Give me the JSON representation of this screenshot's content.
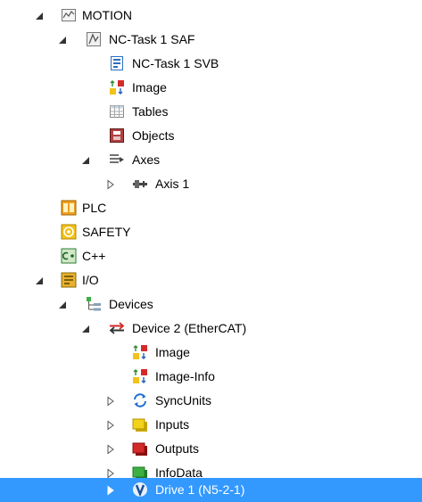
{
  "tree": {
    "motion": {
      "label": "MOTION",
      "icon": "motion-icon"
    },
    "nc_task": {
      "label": "NC-Task 1 SAF",
      "icon": "nc-task-icon"
    },
    "nc_task_svb": {
      "label": "NC-Task 1 SVB",
      "icon": "svb-icon"
    },
    "nc_image": {
      "label": "Image",
      "icon": "image-icon"
    },
    "tables": {
      "label": "Tables",
      "icon": "tables-icon"
    },
    "objects": {
      "label": "Objects",
      "icon": "objects-icon"
    },
    "axes": {
      "label": "Axes",
      "icon": "axes-icon"
    },
    "axis1": {
      "label": "Axis 1",
      "icon": "axis-icon"
    },
    "plc": {
      "label": "PLC",
      "icon": "plc-icon"
    },
    "safety": {
      "label": "SAFETY",
      "icon": "safety-icon"
    },
    "cpp": {
      "label": "C++",
      "icon": "cpp-icon"
    },
    "io": {
      "label": "I/O",
      "icon": "io-icon"
    },
    "devices": {
      "label": "Devices",
      "icon": "devices-icon"
    },
    "device2": {
      "label": "Device 2 (EtherCAT)",
      "icon": "ethercat-icon"
    },
    "dev_image": {
      "label": "Image",
      "icon": "image-icon"
    },
    "dev_image_info": {
      "label": "Image-Info",
      "icon": "image-info-icon"
    },
    "syncunits": {
      "label": "SyncUnits",
      "icon": "sync-icon"
    },
    "inputs": {
      "label": "Inputs",
      "icon": "inputs-icon"
    },
    "outputs": {
      "label": "Outputs",
      "icon": "outputs-icon"
    },
    "infodata": {
      "label": "InfoData",
      "icon": "infodata-icon"
    },
    "drive1": {
      "label": "Drive 1 (N5-2-1)",
      "icon": "drive-icon",
      "selected": true
    }
  },
  "colors": {
    "selection": "#3399ff",
    "inputs": "#f2d21b",
    "outputs": "#d42a2a",
    "infodata": "#3cb043"
  }
}
